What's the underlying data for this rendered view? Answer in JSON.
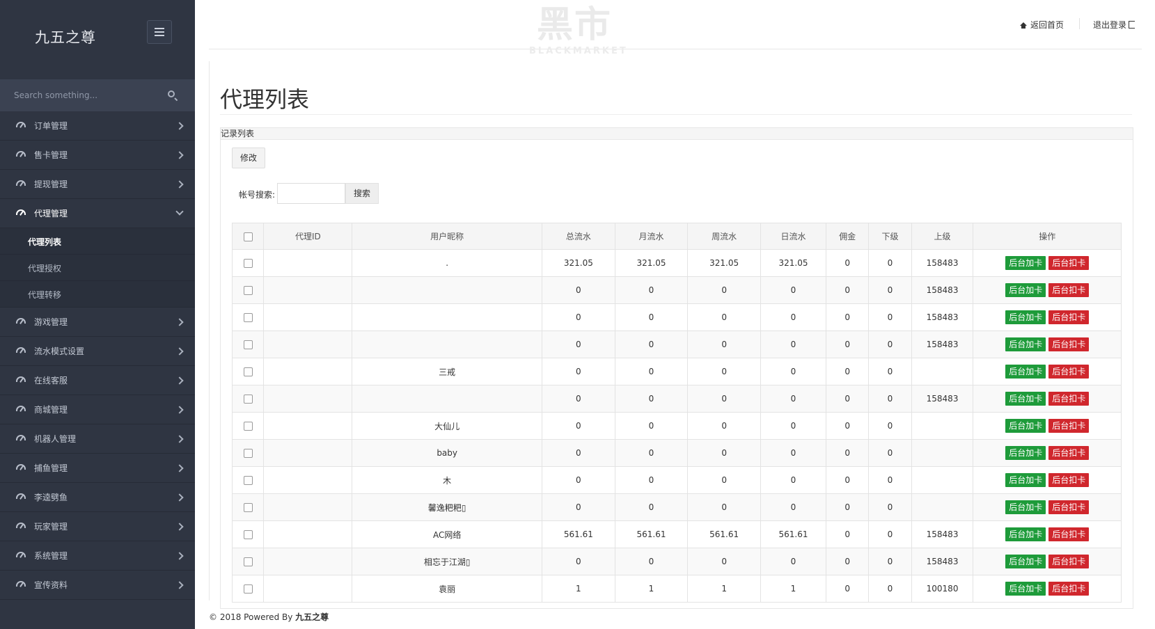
{
  "sidebar": {
    "brand": "九五之尊",
    "search_placeholder": "Search something...",
    "items": [
      {
        "label": "订单管理"
      },
      {
        "label": "售卡管理"
      },
      {
        "label": "提现管理"
      },
      {
        "label": "代理管理"
      },
      {
        "label": "游戏管理"
      },
      {
        "label": "流水模式设置"
      },
      {
        "label": "在线客服"
      },
      {
        "label": "商城管理"
      },
      {
        "label": "机器人管理"
      },
      {
        "label": "捕鱼管理"
      },
      {
        "label": "李逵劈鱼"
      },
      {
        "label": "玩家管理"
      },
      {
        "label": "系统管理"
      },
      {
        "label": "宣传资料"
      }
    ],
    "sub_items": [
      {
        "label": "代理列表"
      },
      {
        "label": "代理授权"
      },
      {
        "label": "代理转移"
      }
    ]
  },
  "header": {
    "watermark_big": "黑市",
    "watermark_small": "BLACKMARKET",
    "home_label": "返回首页",
    "logout_label": "退出登录"
  },
  "page": {
    "title": "代理列表",
    "panel_title": "记录列表",
    "edit_button": "修改",
    "search_label": "帐号搜索:",
    "search_button": "搜索"
  },
  "table": {
    "headers": [
      "代理ID",
      "用户昵称",
      "总流水",
      "月流水",
      "周流水",
      "日流水",
      "佣金",
      "下级",
      "上级",
      "操作"
    ],
    "add_label": "后台加卡",
    "deduct_label": "后台扣卡",
    "rows": [
      {
        "id": "",
        "nick": ".",
        "total": "321.05",
        "month": "321.05",
        "week": "321.05",
        "day": "321.05",
        "comm": "0",
        "sub": "0",
        "parent": "158483"
      },
      {
        "id": "",
        "nick": "",
        "total": "0",
        "month": "0",
        "week": "0",
        "day": "0",
        "comm": "0",
        "sub": "0",
        "parent": "158483"
      },
      {
        "id": "",
        "nick": "",
        "total": "0",
        "month": "0",
        "week": "0",
        "day": "0",
        "comm": "0",
        "sub": "0",
        "parent": "158483"
      },
      {
        "id": "",
        "nick": "",
        "total": "0",
        "month": "0",
        "week": "0",
        "day": "0",
        "comm": "0",
        "sub": "0",
        "parent": "158483"
      },
      {
        "id": "",
        "nick": "三戒",
        "total": "0",
        "month": "0",
        "week": "0",
        "day": "0",
        "comm": "0",
        "sub": "0",
        "parent": ""
      },
      {
        "id": "",
        "nick": "",
        "total": "0",
        "month": "0",
        "week": "0",
        "day": "0",
        "comm": "0",
        "sub": "0",
        "parent": "158483"
      },
      {
        "id": "",
        "nick": "大仙儿",
        "total": "0",
        "month": "0",
        "week": "0",
        "day": "0",
        "comm": "0",
        "sub": "0",
        "parent": ""
      },
      {
        "id": "",
        "nick": "baby",
        "total": "0",
        "month": "0",
        "week": "0",
        "day": "0",
        "comm": "0",
        "sub": "0",
        "parent": ""
      },
      {
        "id": "",
        "nick": "木",
        "total": "0",
        "month": "0",
        "week": "0",
        "day": "0",
        "comm": "0",
        "sub": "0",
        "parent": ""
      },
      {
        "id": "",
        "nick": "馨逸粑粑▯",
        "total": "0",
        "month": "0",
        "week": "0",
        "day": "0",
        "comm": "0",
        "sub": "0",
        "parent": ""
      },
      {
        "id": "",
        "nick": "AC网络",
        "total": "561.61",
        "month": "561.61",
        "week": "561.61",
        "day": "561.61",
        "comm": "0",
        "sub": "0",
        "parent": "158483"
      },
      {
        "id": "",
        "nick": "相忘于江湖▯",
        "total": "0",
        "month": "0",
        "week": "0",
        "day": "0",
        "comm": "0",
        "sub": "0",
        "parent": "158483"
      },
      {
        "id": "",
        "nick": "袁丽",
        "total": "1",
        "month": "1",
        "week": "1",
        "day": "1",
        "comm": "0",
        "sub": "0",
        "parent": "100180"
      }
    ]
  },
  "footer": {
    "prefix": "© 2018 Powered By ",
    "brand": "九五之尊"
  }
}
